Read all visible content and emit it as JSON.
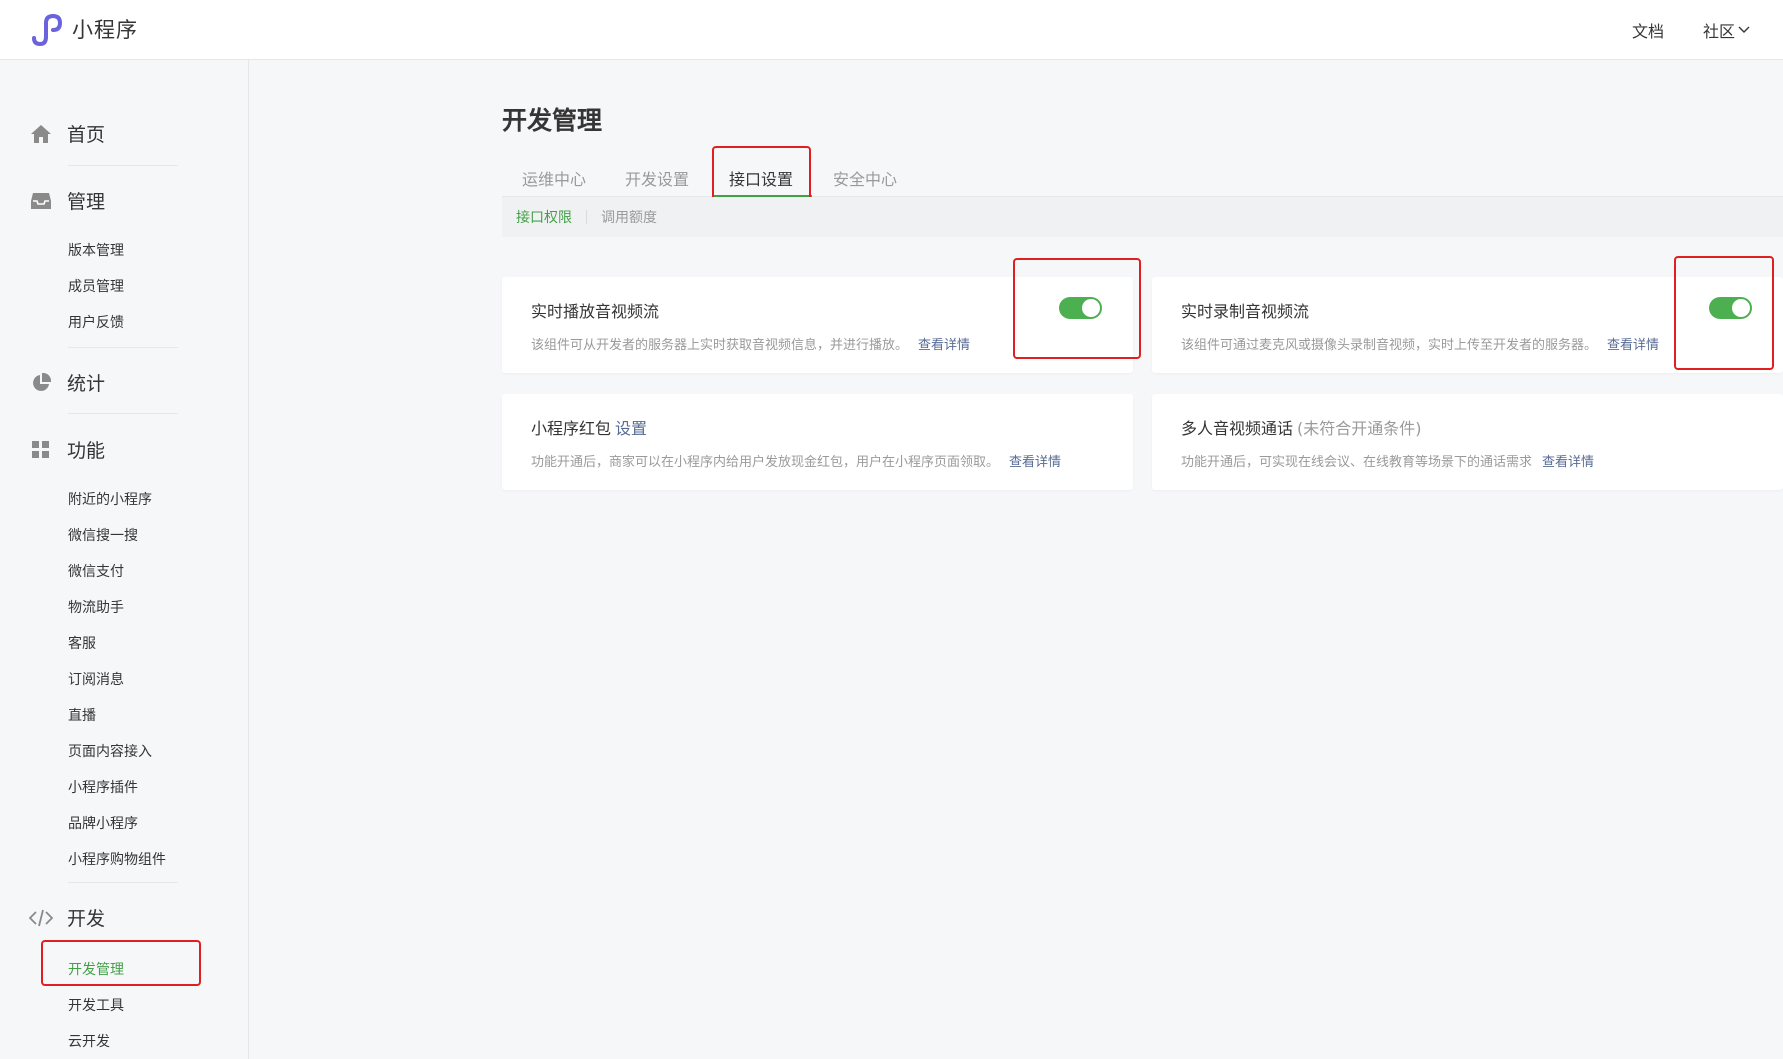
{
  "header": {
    "app_name": "小程序",
    "links": {
      "docs": "文档",
      "community": "社区"
    }
  },
  "sidebar": {
    "groups": {
      "home": "首页",
      "manage": "管理",
      "stats": "统计",
      "features": "功能",
      "dev": "开发"
    },
    "manage_items": [
      "版本管理",
      "成员管理",
      "用户反馈"
    ],
    "feature_items": [
      "附近的小程序",
      "微信搜一搜",
      "微信支付",
      "物流助手",
      "客服",
      "订阅消息",
      "直播",
      "页面内容接入",
      "小程序插件",
      "品牌小程序",
      "小程序购物组件"
    ],
    "dev_items": [
      "开发管理",
      "开发工具",
      "云开发"
    ],
    "active_item": "开发管理"
  },
  "main": {
    "title": "开发管理",
    "tabs": [
      "运维中心",
      "开发设置",
      "接口设置",
      "安全中心"
    ],
    "active_tab": "接口设置",
    "subtabs": [
      "接口权限",
      "调用额度"
    ],
    "active_subtab": "接口权限",
    "cards": [
      {
        "title": "实时播放音视频流",
        "desc": "该组件可从开发者的服务器上实时获取音视频信息，并进行播放。",
        "detail": "查看详情",
        "toggle_on": true
      },
      {
        "title": "实时录制音视频流",
        "desc": "该组件可通过麦克风或摄像头录制音视频，实时上传至开发者的服务器。",
        "detail": "查看详情",
        "toggle_on": true
      },
      {
        "title": "小程序红包",
        "title_link": "设置",
        "desc": "功能开通后，商家可以在小程序内给用户发放现金红包，用户在小程序页面领取。",
        "detail": "查看详情"
      },
      {
        "title": "多人音视频通话",
        "title_note": "(未符合开通条件)",
        "desc": "功能开通后，可实现在线会议、在线教育等场景下的通话需求",
        "detail": "查看详情"
      }
    ]
  },
  "colors": {
    "accent_green": "#43a047",
    "link_blue": "#576b95",
    "highlight_red": "#e02020"
  }
}
